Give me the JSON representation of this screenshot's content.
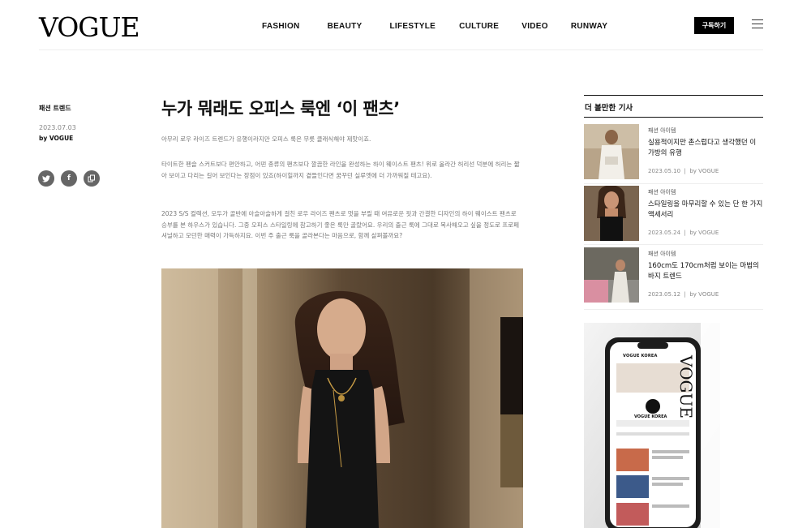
{
  "header": {
    "logo": "VOGUE",
    "nav": [
      "FASHION",
      "BEAUTY",
      "LIFESTYLE",
      "CULTURE",
      "VIDEO",
      "RUNWAY"
    ],
    "subscribe_label": "구독하기"
  },
  "meta": {
    "category": "패션 트렌드",
    "date": "2023.07.03",
    "author": "by VOGUE",
    "share_icons": [
      "twitter-icon",
      "facebook-icon",
      "copy-link-icon"
    ]
  },
  "article": {
    "title": "누가 뭐래도 오피스 룩엔 ‘이 팬츠’",
    "paragraphs": [
      "아무리 로우 라이즈 트렌드가 유행이라지만 오피스 룩은 무릇 클래식해야 제맛이죠.",
      "타이트한 펜슬 스커트보다 편안하고, 어떤 종류의 팬츠보다 깔끔한 라인을 완성하는 하이 웨이스트 팬츠! 위로 올라간 허리선 덕분에 허리는 짧아 보이고 다리는 길어 보인다는 장점이 있죠(하이힐까지 곁들인다면 꿈꾸던 실루엣에 더 가까워질 테고요).",
      "2023 S/S 컬렉션, 모두가 골반에 아슬아슬하게 걸친 로우 라이즈 팬츠로 멋을 부릴 때 여유로운 핏과 간결한 디자인의 하이 웨이스트 팬츠로 승부를 본 하우스가 있습니다. 그중 오피스 스타일링에 참고하기 좋은 룩만 골랐어요. 우리의 출근 룩에 그대로 복사해오고 싶을 정도로 프로페셔널하고 모던한 매력이 가득하지요. 이번 주 출근 룩을 골라본다는 마음으로, 함께 살펴볼까요?"
    ]
  },
  "sidebar": {
    "heading": "더 볼만한 기사",
    "cards": [
      {
        "category": "패션 아이템",
        "title": "실용적이지만 촌스럽다고 생각했던 이 가방의 유행",
        "date": "2023.05.10",
        "author": "by VOGUE"
      },
      {
        "category": "패션 아이템",
        "title": "스타일링을 마무리할 수 있는 단 한 가지 액세서리",
        "date": "2023.05.24",
        "author": "by VOGUE"
      },
      {
        "category": "패션 아이템",
        "title": "160cm도 170cm처럼 보이는 마법의 바지 트렌드",
        "date": "2023.05.12",
        "author": "by VOGUE"
      }
    ],
    "ad": {
      "vertical_logo": "VOGUE",
      "app_header": "VOGUE KOREA",
      "app_title": "VOGUE KOREA"
    }
  }
}
